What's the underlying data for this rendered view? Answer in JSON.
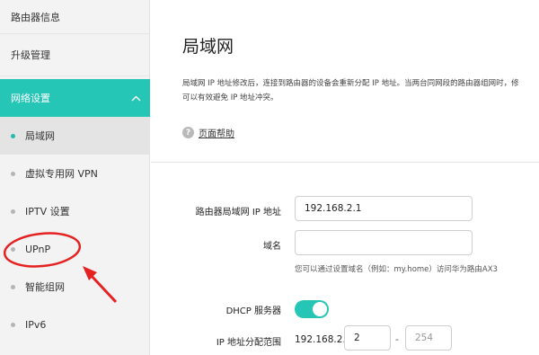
{
  "sidebar": {
    "top_items": [
      {
        "label": "路由器信息"
      },
      {
        "label": "升级管理"
      }
    ],
    "section": {
      "label": "网络设置",
      "expanded": true
    },
    "sub_items": [
      {
        "label": "局域网",
        "active": true
      },
      {
        "label": "虚拟专用网 VPN",
        "active": false
      },
      {
        "label": "IPTV 设置",
        "active": false
      },
      {
        "label": "UPnP",
        "active": false
      },
      {
        "label": "智能组网",
        "active": false
      },
      {
        "label": "IPv6",
        "active": false
      }
    ]
  },
  "main": {
    "title": "局域网",
    "description_line1": "局域网 IP 地址修改后，连接到路由器的设备会重新分配 IP 地址。当两台同网段的路由器组网时，修",
    "description_line2": "可以有效避免 IP 地址冲突。",
    "help_label": "页面帮助",
    "form": {
      "ip_label": "路由器局域网 IP 地址",
      "ip_value": "192.168.2.1",
      "domain_label": "域名",
      "domain_value": "",
      "domain_hint": "您可以通过设置域名（例如：my.home）访问华为路由AX3",
      "dhcp_label": "DHCP 服务器",
      "dhcp_enabled": true,
      "range_label": "IP 地址分配范围",
      "range_prefix": "192.168.2.",
      "range_start": "2",
      "range_sep": "-",
      "range_end": "254"
    }
  },
  "colors": {
    "accent": "#26c6b6",
    "annotation": "#e52222"
  }
}
